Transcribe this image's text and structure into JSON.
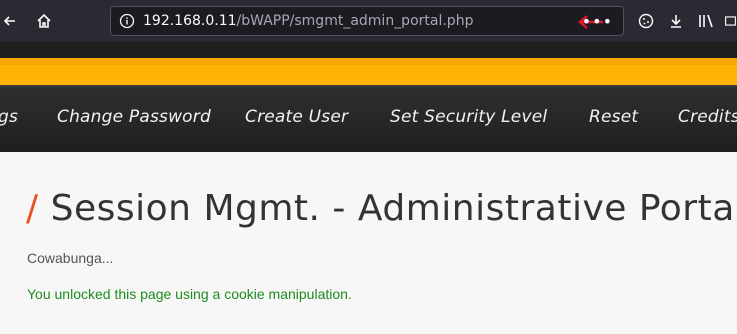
{
  "browser": {
    "url_host": "192.168.0.11",
    "url_path": "/bWAPP/smgmt_admin_portal.php",
    "icons": [
      "back-icon",
      "home-icon",
      "info-icon",
      "red-arrow-icon",
      "more-icon",
      "cookie-icon",
      "download-icon",
      "library-icon",
      "reader-icon"
    ]
  },
  "nav": {
    "items": [
      "gs",
      "Change Password",
      "Create User",
      "Set Security Level",
      "Reset",
      "Credits"
    ]
  },
  "page": {
    "title": "Session Mgmt. - Administrative Portals",
    "message": "Cowabunga...",
    "success": "You unlocked this page using a cookie manipulation.",
    "accent_color": "#e8511f",
    "success_color": "#1f8b1f",
    "band_color": "#ffb405"
  }
}
